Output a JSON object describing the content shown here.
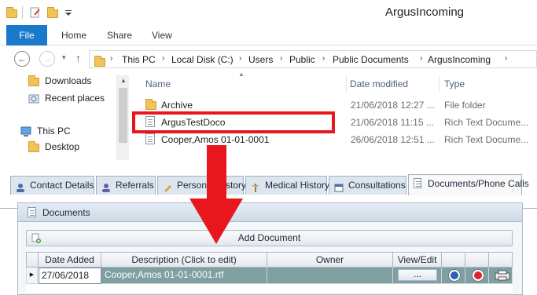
{
  "explorer": {
    "window_title": "ArgusIncoming",
    "ribbon": {
      "file": "File",
      "home": "Home",
      "share": "Share",
      "view": "View"
    },
    "nav": {
      "back": "←",
      "forward": "→",
      "up": "↑",
      "dropdown": "▾"
    },
    "breadcrumb": [
      "This PC",
      "Local Disk (C:)",
      "Users",
      "Public",
      "Public Documents",
      "ArgusIncoming"
    ],
    "breadcrumb_sep": "›",
    "nav_pane": {
      "items": [
        {
          "label": "Downloads",
          "icon": "downloads-folder-icon"
        },
        {
          "label": "Recent places",
          "icon": "recent-places-icon"
        },
        {
          "label": "This PC",
          "icon": "computer-icon"
        },
        {
          "label": "Desktop",
          "icon": "folder-icon"
        }
      ]
    },
    "columns": {
      "name": "Name",
      "date": "Date modified",
      "type": "Type"
    },
    "sort_glyph": "▲",
    "files": [
      {
        "name": "Archive",
        "date": "21/06/2018 12:27 ...",
        "type": "File folder",
        "icon": "folder-icon"
      },
      {
        "name": "ArgusTestDoco",
        "date": "21/06/2018 11:15 ...",
        "type": "Rich Text Docume...",
        "icon": "document-icon"
      },
      {
        "name": "Cooper,Amos 01-01-0001",
        "date": "26/06/2018 12:51 ...",
        "type": "Rich Text Docume...",
        "icon": "document-icon"
      }
    ],
    "highlight_color": "#e8161d"
  },
  "app": {
    "tabs": [
      {
        "label": "Contact Details",
        "icon": "contact-icon",
        "active": false
      },
      {
        "label": "Referrals",
        "icon": "referrals-icon",
        "active": false
      },
      {
        "label": "Personal History",
        "icon": "pencil-icon",
        "active": false
      },
      {
        "label": "Medical History",
        "icon": "caduceus-icon",
        "active": false
      },
      {
        "label": "Consultations",
        "icon": "calendar-icon",
        "active": false
      },
      {
        "label": "Documents/Phone Calls",
        "icon": "document-icon",
        "active": true
      }
    ],
    "documents_panel": {
      "title": "Documents",
      "add_button": "Add Document",
      "columns": [
        "Date Added",
        "Description (Click to edit)",
        "Owner",
        "View/Edit"
      ],
      "rows": [
        {
          "indicator": "▶",
          "date_added": "27/06/2018",
          "description": "Cooper,Amos 01-01-0001.rtf",
          "owner": "",
          "view_edit": "..."
        }
      ]
    }
  },
  "colors": {
    "accent_blue": "#1979ca",
    "annotation_red": "#e8161d",
    "selected_row": "#7f9fa1"
  }
}
